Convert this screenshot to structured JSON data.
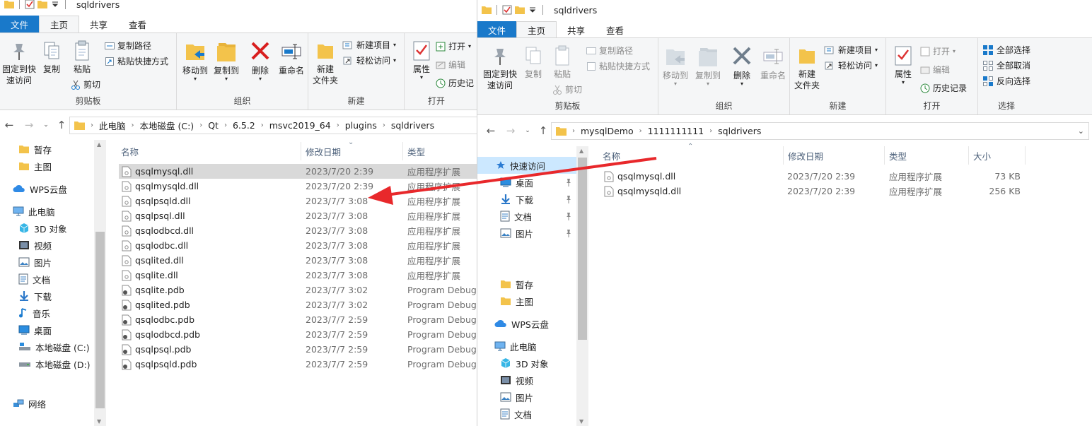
{
  "colors": {
    "accent": "#1979ca",
    "selection": "#cce8ff",
    "row_selected": "#d9d9d9",
    "annotation_arrow": "#e8282b",
    "folder": "#f3c34b"
  },
  "left": {
    "title": "sqldrivers",
    "tabs": [
      "文件",
      "主页",
      "共享",
      "查看"
    ],
    "ribbon": {
      "pin_label_1": "固定到快",
      "pin_label_2": "速访问",
      "copy": "复制",
      "paste": "粘贴",
      "copy_path": "复制路径",
      "paste_shortcut": "粘贴快捷方式",
      "cut": "剪切",
      "group_clipboard": "剪贴板",
      "move_to": "移动到",
      "copy_to": "复制到",
      "delete": "删除",
      "rename": "重命名",
      "group_organize": "组织",
      "new_folder_1": "新建",
      "new_folder_2": "文件夹",
      "new_item": "新建项目",
      "easy_access": "轻松访问",
      "group_new": "新建",
      "properties": "属性",
      "open": "打开",
      "edit": "编辑",
      "history": "历史记",
      "group_open": "打开"
    },
    "breadcrumb": [
      "此电脑",
      "本地磁盘 (C:)",
      "Qt",
      "6.5.2",
      "msvc2019_64",
      "plugins",
      "sqldrivers"
    ],
    "nav": [
      {
        "label": "暂存",
        "icon": "folder-icon"
      },
      {
        "label": "主图",
        "icon": "folder-icon"
      },
      {
        "label": "WPS云盘",
        "icon": "cloud-icon"
      },
      {
        "label": "此电脑",
        "icon": "computer-icon"
      },
      {
        "label": "3D 对象",
        "icon": "cube-icon"
      },
      {
        "label": "视频",
        "icon": "video-icon"
      },
      {
        "label": "图片",
        "icon": "pictures-icon"
      },
      {
        "label": "文档",
        "icon": "documents-icon"
      },
      {
        "label": "下载",
        "icon": "download-icon"
      },
      {
        "label": "音乐",
        "icon": "music-icon"
      },
      {
        "label": "桌面",
        "icon": "desktop-icon"
      },
      {
        "label": "本地磁盘 (C:)",
        "icon": "drive-c-icon"
      },
      {
        "label": "本地磁盘 (D:)",
        "icon": "drive-icon"
      },
      {
        "label": "网络",
        "icon": "network-icon"
      }
    ],
    "columns": {
      "name": "名称",
      "date": "修改日期",
      "type": "类型"
    },
    "files": [
      {
        "name": "qsqlmysql.dll",
        "date": "2023/7/20 2:39",
        "type": "应用程序扩展",
        "kind": "dll"
      },
      {
        "name": "qsqlmysqld.dll",
        "date": "2023/7/20 2:39",
        "type": "应用程序扩展",
        "kind": "dll"
      },
      {
        "name": "qsqlpsqld.dll",
        "date": "2023/7/7 3:08",
        "type": "应用程序扩展",
        "kind": "dll"
      },
      {
        "name": "qsqlpsql.dll",
        "date": "2023/7/7 3:08",
        "type": "应用程序扩展",
        "kind": "dll"
      },
      {
        "name": "qsqlodbcd.dll",
        "date": "2023/7/7 3:08",
        "type": "应用程序扩展",
        "kind": "dll"
      },
      {
        "name": "qsqlodbc.dll",
        "date": "2023/7/7 3:08",
        "type": "应用程序扩展",
        "kind": "dll"
      },
      {
        "name": "qsqlited.dll",
        "date": "2023/7/7 3:08",
        "type": "应用程序扩展",
        "kind": "dll"
      },
      {
        "name": "qsqlite.dll",
        "date": "2023/7/7 3:08",
        "type": "应用程序扩展",
        "kind": "dll"
      },
      {
        "name": "qsqlite.pdb",
        "date": "2023/7/7 3:02",
        "type": "Program Debug...",
        "kind": "pdb"
      },
      {
        "name": "qsqlited.pdb",
        "date": "2023/7/7 3:02",
        "type": "Program Debug...",
        "kind": "pdb"
      },
      {
        "name": "qsqlodbc.pdb",
        "date": "2023/7/7 2:59",
        "type": "Program Debug...",
        "kind": "pdb"
      },
      {
        "name": "qsqlodbcd.pdb",
        "date": "2023/7/7 2:59",
        "type": "Program Debug...",
        "kind": "pdb"
      },
      {
        "name": "qsqlpsql.pdb",
        "date": "2023/7/7 2:59",
        "type": "Program Debug...",
        "kind": "pdb"
      },
      {
        "name": "qsqlpsqld.pdb",
        "date": "2023/7/7 2:59",
        "type": "Program Debug...",
        "kind": "pdb"
      }
    ]
  },
  "right": {
    "title": "sqldrivers",
    "tabs": [
      "文件",
      "主页",
      "共享",
      "查看"
    ],
    "ribbon": {
      "pin_label_1": "固定到快",
      "pin_label_2": "速访问",
      "copy": "复制",
      "paste": "粘贴",
      "copy_path": "复制路径",
      "paste_shortcut": "粘贴快捷方式",
      "cut": "剪切",
      "group_clipboard": "剪贴板",
      "move_to": "移动到",
      "copy_to": "复制到",
      "delete": "删除",
      "rename": "重命名",
      "group_organize": "组织",
      "new_folder_1": "新建",
      "new_folder_2": "文件夹",
      "new_item": "新建项目",
      "easy_access": "轻松访问",
      "group_new": "新建",
      "properties": "属性",
      "open": "打开",
      "edit": "编辑",
      "history": "历史记录",
      "group_open": "打开",
      "select_all": "全部选择",
      "select_none": "全部取消",
      "invert_selection": "反向选择",
      "group_select": "选择"
    },
    "breadcrumb": [
      "mysqlDemo",
      "1111111111",
      "sqldrivers"
    ],
    "nav": [
      {
        "label": "快速访问",
        "icon": "star-icon",
        "selected": true
      },
      {
        "label": "桌面",
        "icon": "desktop-icon",
        "pinned": true
      },
      {
        "label": "下载",
        "icon": "download-icon",
        "pinned": true
      },
      {
        "label": "文档",
        "icon": "documents-icon",
        "pinned": true
      },
      {
        "label": "图片",
        "icon": "pictures-icon",
        "pinned": true
      },
      {
        "label": "暂存",
        "icon": "folder-icon"
      },
      {
        "label": "主图",
        "icon": "folder-icon"
      },
      {
        "label": "WPS云盘",
        "icon": "cloud-icon"
      },
      {
        "label": "此电脑",
        "icon": "computer-icon"
      },
      {
        "label": "3D 对象",
        "icon": "cube-icon"
      },
      {
        "label": "视频",
        "icon": "video-icon"
      },
      {
        "label": "图片",
        "icon": "pictures-icon"
      },
      {
        "label": "文档",
        "icon": "documents-icon"
      }
    ],
    "columns": {
      "name": "名称",
      "date": "修改日期",
      "type": "类型",
      "size": "大小"
    },
    "files": [
      {
        "name": "qsqlmysql.dll",
        "date": "2023/7/20 2:39",
        "type": "应用程序扩展",
        "size": "73 KB",
        "kind": "dll"
      },
      {
        "name": "qsqlmysqld.dll",
        "date": "2023/7/20 2:39",
        "type": "应用程序扩展",
        "size": "256 KB",
        "kind": "dll"
      }
    ]
  }
}
